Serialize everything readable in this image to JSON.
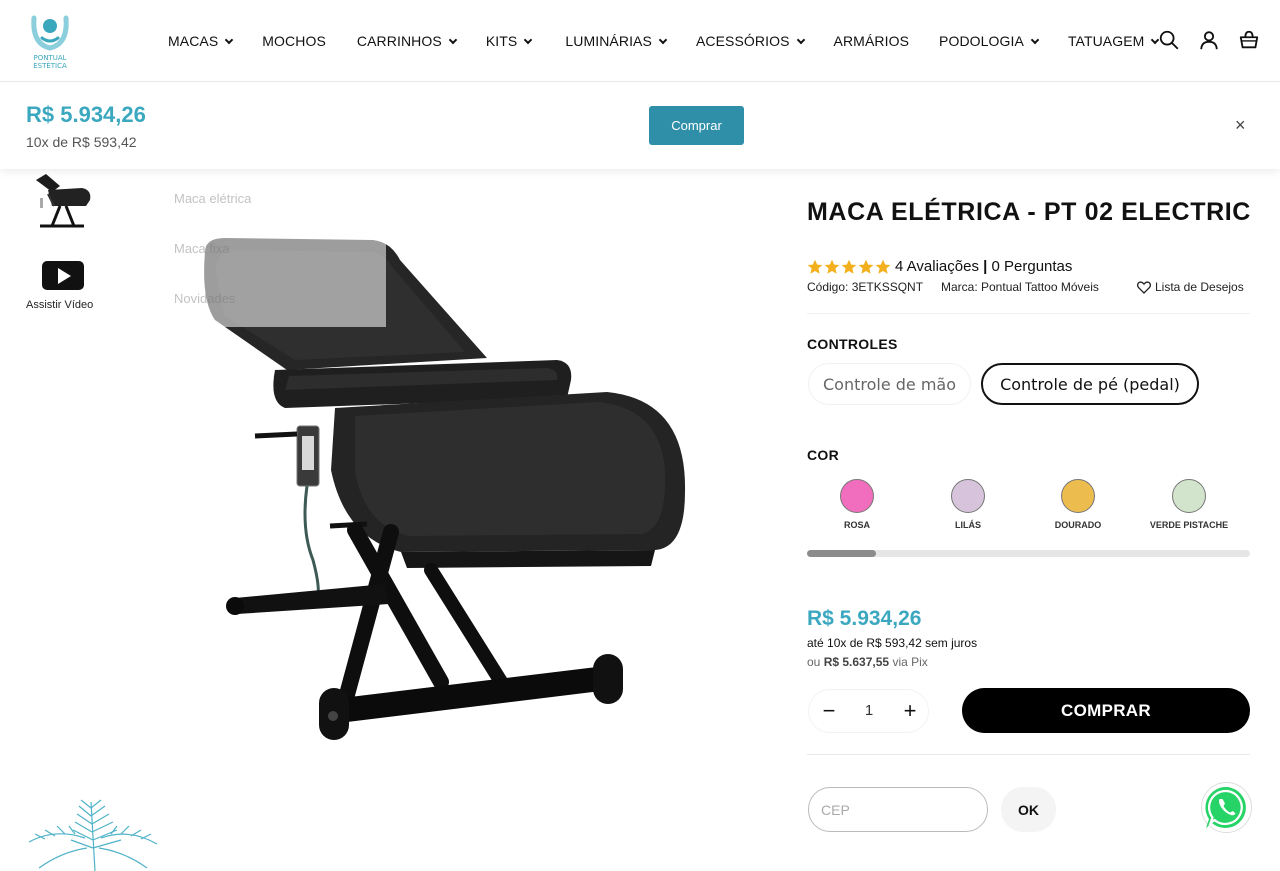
{
  "brand": {
    "logo_text": "PONTUAL ESTÉTICA",
    "accent_color": "#3ba8c0"
  },
  "nav": {
    "items": [
      {
        "label": "MACAS",
        "has_dropdown": true
      },
      {
        "label": "MOCHOS",
        "has_dropdown": false
      },
      {
        "label": "CARRINHOS",
        "has_dropdown": true
      },
      {
        "label": "KITS",
        "has_dropdown": true
      },
      {
        "label": "LUMINÁRIAS",
        "has_dropdown": true
      },
      {
        "label": "ACESSÓRIOS",
        "has_dropdown": true
      },
      {
        "label": "ARMÁRIOS",
        "has_dropdown": false
      },
      {
        "label": "PODOLOGIA",
        "has_dropdown": true
      },
      {
        "label": "TATUAGEM",
        "has_dropdown": true
      }
    ],
    "icons": [
      "search-icon",
      "account-icon",
      "cart-icon"
    ],
    "dropdown_items": [
      "Maca elétrica",
      "Maca fixa",
      "Novidades"
    ]
  },
  "sticky_bar": {
    "price": "R$ 5.934,26",
    "installments": "10x de R$ 593,42",
    "button_label": "Comprar",
    "close_label": "×"
  },
  "gallery": {
    "video_label": "Assistir Vídeo"
  },
  "product": {
    "title": "MACA ELÉTRICA - PT 02 ELECTRIC",
    "rating": 5,
    "reviews_text": "4 Avaliações",
    "divider": "|",
    "questions_text": "0 Perguntas",
    "code": "Código: 3ETKSSQNT",
    "brand": "Marca: Pontual Tattoo Móveis",
    "wishlist": "Lista de Desejos"
  },
  "options": {
    "controls_label": "CONTROLES",
    "controls": [
      {
        "label": "Controle de mão",
        "selected": false
      },
      {
        "label": "Controle de pé (pedal)",
        "selected": true
      }
    ],
    "color_label": "COR",
    "colors": [
      {
        "name": "ROSA",
        "hex": "#f06ebd"
      },
      {
        "name": "LILÁS",
        "hex": "#d8c3dd"
      },
      {
        "name": "DOURADO",
        "hex": "#ecbc4f"
      },
      {
        "name": "VERDE PISTACHE",
        "hex": "#d3e4cd"
      }
    ],
    "color_scroll_position": 0.155
  },
  "pricing": {
    "price": "R$ 5.934,26",
    "installments": "até 10x de R$ 593,42 sem juros",
    "pix_prefix": "ou",
    "pix_value": "R$ 5.637,55",
    "pix_suffix": "via Pix"
  },
  "purchase": {
    "quantity": "1",
    "minus": "−",
    "plus": "+",
    "buy_label": "COMPRAR"
  },
  "shipping": {
    "cep_placeholder": "CEP",
    "ok_label": "OK"
  }
}
